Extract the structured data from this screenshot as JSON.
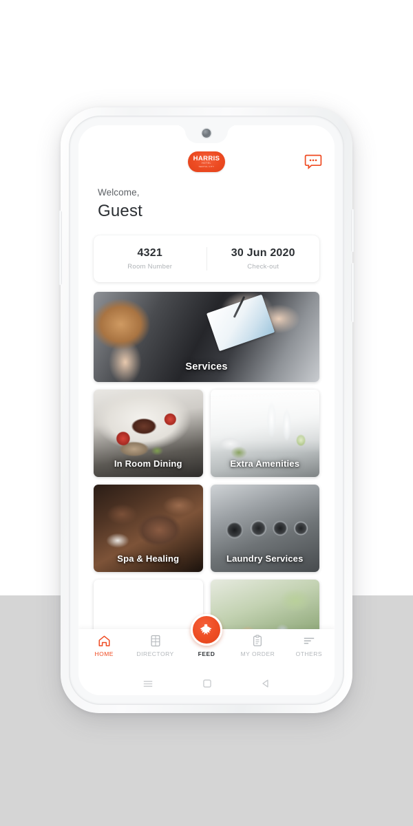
{
  "brand": {
    "accent": "#ef4a21",
    "logo_main": "HARRIS",
    "logo_sub1": "HOTEL",
    "logo_sub2": "SENTUL CITY"
  },
  "header": {
    "logo_icon": "harris-logo",
    "chat_icon": "chat-bubble-icon"
  },
  "welcome": {
    "greeting": "Welcome,",
    "name": "Guest"
  },
  "info_card": {
    "cells": [
      {
        "value": "4321",
        "label": "Room Number"
      },
      {
        "value": "30 Jun 2020",
        "label": "Check-out"
      }
    ]
  },
  "tiles": {
    "featured": {
      "label": "Services",
      "image": "concierge-writing-photo"
    },
    "grid": [
      {
        "label": "In Room Dining",
        "image": "gourmet-plate-photo"
      },
      {
        "label": "Extra Amenities",
        "image": "white-bottles-photo"
      },
      {
        "label": "Spa & Healing",
        "image": "massage-photo"
      },
      {
        "label": "Laundry Services",
        "image": "washing-machines-photo"
      }
    ],
    "partial": [
      {
        "label": "",
        "image": "market-stalls-photo"
      },
      {
        "label": "",
        "image": "outdoor-garden-photo"
      }
    ]
  },
  "tabbar": {
    "items": [
      {
        "label": "HOME",
        "icon": "home-icon",
        "state": "active"
      },
      {
        "label": "DIRECTORY",
        "icon": "directory-icon",
        "state": "inactive"
      },
      {
        "label": "FEED",
        "icon": "feed-bird-icon",
        "state": "center"
      },
      {
        "label": "MY ORDER",
        "icon": "clipboard-icon",
        "state": "inactive"
      },
      {
        "label": "OTHERS",
        "icon": "menu-lines-icon",
        "state": "inactive"
      }
    ]
  },
  "sysnav": {
    "recents_icon": "hamburger-icon",
    "home_icon": "square-icon",
    "back_icon": "back-triangle-icon"
  }
}
